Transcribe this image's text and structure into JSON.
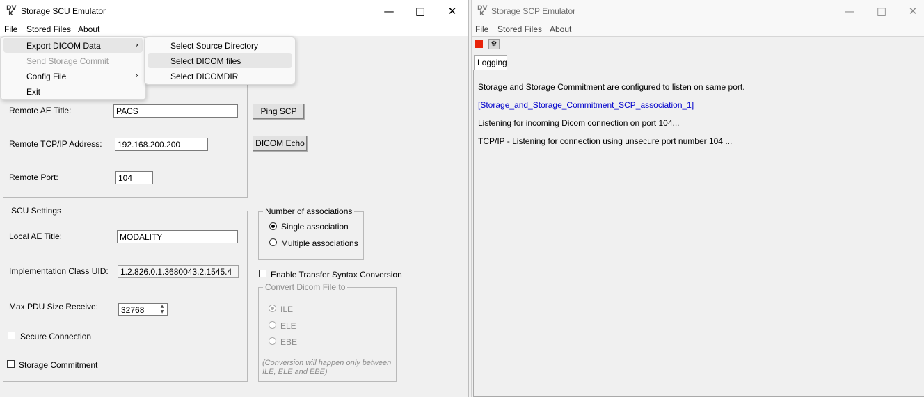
{
  "scu": {
    "title": "Storage SCU Emulator",
    "menu": [
      "File",
      "Stored Files",
      "About"
    ],
    "file_menu": {
      "items": [
        "Export DICOM Data",
        "Send Storage Commit",
        "Config File",
        "Exit"
      ],
      "submenu": [
        "Select Source Directory",
        "Select DICOM files",
        "Select DICOMDIR"
      ]
    },
    "remote": {
      "ae_title_label": "Remote AE Title:",
      "ae_title_value": "PACS",
      "ip_label": "Remote TCP/IP Address:",
      "ip_value": "192.168.200.200",
      "port_label": "Remote Port:",
      "port_value": "104",
      "ping_button": "Ping SCP",
      "echo_button": "DICOM Echo"
    },
    "scu_settings": {
      "group_label": "SCU Settings",
      "local_ae_label": "Local AE Title:",
      "local_ae_value": "MODALITY",
      "impl_uid_label": "Implementation Class UID:",
      "impl_uid_value": "1.2.826.0.1.3680043.2.1545.4",
      "max_pdu_label": "Max PDU Size Receive:",
      "max_pdu_value": "32768",
      "secure_label": "Secure Connection",
      "commit_label": "Storage Commitment"
    },
    "associations": {
      "group_label": "Number of associations",
      "single": "Single association",
      "multiple": "Multiple associations"
    },
    "conversion": {
      "enable_label": "Enable Transfer Syntax Conversion",
      "group_label": "Convert Dicom File to",
      "options": [
        "ILE",
        "ELE",
        "EBE"
      ],
      "note": "(Conversion will happen only between ILE, ELE and EBE)"
    }
  },
  "scp": {
    "title": "Storage SCP Emulator",
    "menu": [
      "File",
      "Stored Files",
      "About"
    ],
    "tab": "Logging",
    "log": [
      "Storage and Storage Commitment are configured to listen on same port.",
      "[Storage_and_Storage_Commitment_SCP_association_1]",
      "Listening for incoming Dicom connection on port 104...",
      "TCP/IP - Listening for connection using unsecure port number 104 ..."
    ]
  },
  "colors": {
    "log_highlight": "#0000cc",
    "stop_button": "#e8230a"
  }
}
